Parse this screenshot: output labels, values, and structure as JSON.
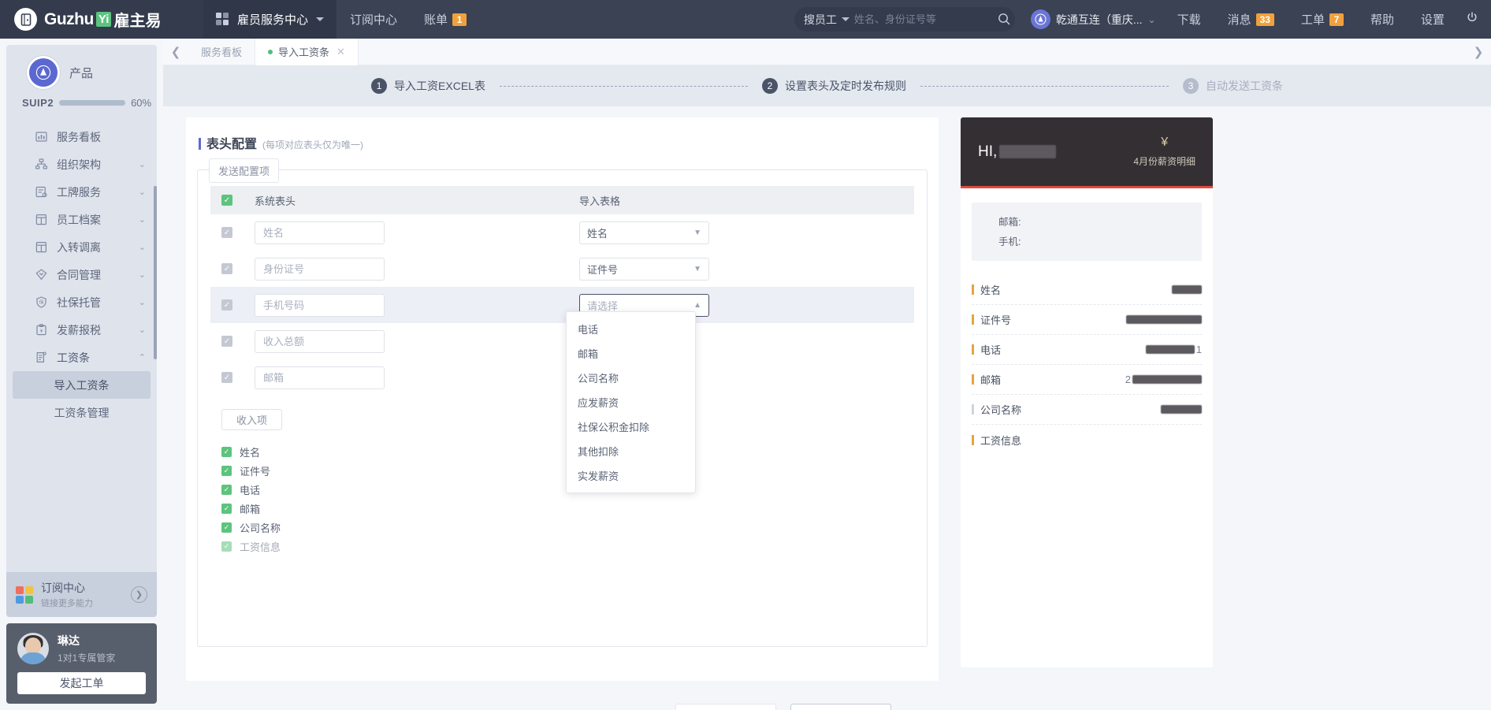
{
  "topbar": {
    "logo_word": "Guzhu",
    "logo_yi": "Yi",
    "logo_cn": "雇主易",
    "logo_icon": "door-logo-icon",
    "app_switcher": "雇员服务中心",
    "nav_links": [
      {
        "label": "订阅中心",
        "badge": ""
      },
      {
        "label": "账单",
        "badge": "1"
      }
    ],
    "search": {
      "scope": "搜员工",
      "placeholder": "姓名、身份证号等",
      "value": ""
    },
    "org": {
      "name": "乾通互连（重庆...",
      "avatar_text": "乾通互连"
    },
    "right_links": [
      {
        "label": "下载",
        "badge": ""
      },
      {
        "label": "消息",
        "badge": "33"
      },
      {
        "label": "工单",
        "badge": "7"
      },
      {
        "label": "帮助",
        "badge": ""
      },
      {
        "label": "设置",
        "badge": ""
      }
    ],
    "power_icon": "power-icon"
  },
  "sidebar": {
    "brand": {
      "label": "产品",
      "avatar_text": "乾通互连"
    },
    "vip": {
      "tag": "SUIP2",
      "percent_label": "60%",
      "percent": 60
    },
    "menu": [
      {
        "label": "服务看板",
        "icon": "dashboard-icon",
        "expandable": false
      },
      {
        "label": "组织架构",
        "icon": "org-tree-icon",
        "expandable": true
      },
      {
        "label": "工牌服务",
        "icon": "badge-card-icon",
        "expandable": true
      },
      {
        "label": "员工档案",
        "icon": "employee-file-icon",
        "expandable": true
      },
      {
        "label": "入转调离",
        "icon": "transfer-icon",
        "expandable": true
      },
      {
        "label": "合同管理",
        "icon": "contract-icon",
        "expandable": true
      },
      {
        "label": "社保托管",
        "icon": "shield-insurance-icon",
        "expandable": true
      },
      {
        "label": "发薪报税",
        "icon": "payroll-tax-icon",
        "expandable": true
      },
      {
        "label": "工资条",
        "icon": "payslip-icon",
        "expandable": true,
        "expanded": true
      }
    ],
    "submenu": [
      {
        "label": "导入工资条",
        "selected": true
      },
      {
        "label": "工资条管理",
        "selected": false
      }
    ],
    "subscription": {
      "title": "订阅中心",
      "subtitle": "链接更多能力",
      "arrow_icon": "chevron-right-circle-icon"
    },
    "agent": {
      "name": "琳达",
      "role": "1对1专属管家",
      "button": "发起工单"
    }
  },
  "tabbar": {
    "back_icon": "chevron-left-icon",
    "forward_icon": "chevron-right-icon",
    "tabs": [
      {
        "label": "服务看板",
        "active": false,
        "closable": false
      },
      {
        "label": "导入工资条",
        "active": true,
        "closable": true
      }
    ]
  },
  "stepper": {
    "steps": [
      {
        "num": "1",
        "label": "导入工资EXCEL表",
        "state": "done"
      },
      {
        "num": "2",
        "label": "设置表头及定时发布规则",
        "state": "current"
      },
      {
        "num": "3",
        "label": "自动发送工资条",
        "state": "inactive"
      }
    ]
  },
  "main": {
    "section_title": "表头配置",
    "section_sub": "(每项对应表头仅为唯一)",
    "fieldset_legend": "发送配置项",
    "table": {
      "header_checkbox_checked": true,
      "columns": [
        "系统表头",
        "导入表格"
      ],
      "rows": [
        {
          "checked": true,
          "sys_placeholder": "姓名",
          "import_value": "姓名",
          "is_placeholder": false,
          "open": false,
          "highlight": false
        },
        {
          "checked": true,
          "sys_placeholder": "身份证号",
          "import_value": "证件号",
          "is_placeholder": false,
          "open": false,
          "highlight": false
        },
        {
          "checked": true,
          "sys_placeholder": "手机号码",
          "import_value": "请选择",
          "is_placeholder": true,
          "open": true,
          "highlight": true
        },
        {
          "checked": true,
          "sys_placeholder": "收入总额",
          "import_value": "",
          "is_placeholder": false,
          "open": false,
          "highlight": false
        },
        {
          "checked": true,
          "sys_placeholder": "邮箱",
          "import_value": "",
          "is_placeholder": false,
          "open": false,
          "highlight": false
        }
      ]
    },
    "dropdown_options": [
      "电话",
      "邮箱",
      "公司名称",
      "应发薪资",
      "社保公积金扣除",
      "其他扣除",
      "实发薪资"
    ],
    "income_button": "收入项",
    "income_items": [
      {
        "label": "姓名",
        "checked": true
      },
      {
        "label": "证件号",
        "checked": true
      },
      {
        "label": "电话",
        "checked": true
      },
      {
        "label": "邮箱",
        "checked": true
      },
      {
        "label": "公司名称",
        "checked": true
      },
      {
        "label": "工资信息",
        "checked": true
      }
    ]
  },
  "preview": {
    "greeting": "HI,",
    "currency_symbol": "¥",
    "month_label": "4月份薪资明细",
    "contact": {
      "email_label": "邮箱:",
      "phone_label": "手机:"
    },
    "rows": [
      {
        "label": "姓名",
        "value": "",
        "accent": "orange"
      },
      {
        "label": "证件号",
        "value": "",
        "accent": "orange"
      },
      {
        "label": "电话",
        "value": "1",
        "accent": "orange"
      },
      {
        "label": "邮箱",
        "value": "2",
        "accent": "orange"
      },
      {
        "label": "公司名称",
        "value": "",
        "accent": "grey"
      },
      {
        "label": "工资信息",
        "value": "",
        "accent": "orange"
      }
    ]
  },
  "colors": {
    "topbar_bg": "#3a4254",
    "accent_blue": "#5b6ad0",
    "green": "#5cc47d",
    "orange_badge": "#f0a13c",
    "preview_red": "#e04a3f",
    "preview_dark": "#332f33"
  }
}
